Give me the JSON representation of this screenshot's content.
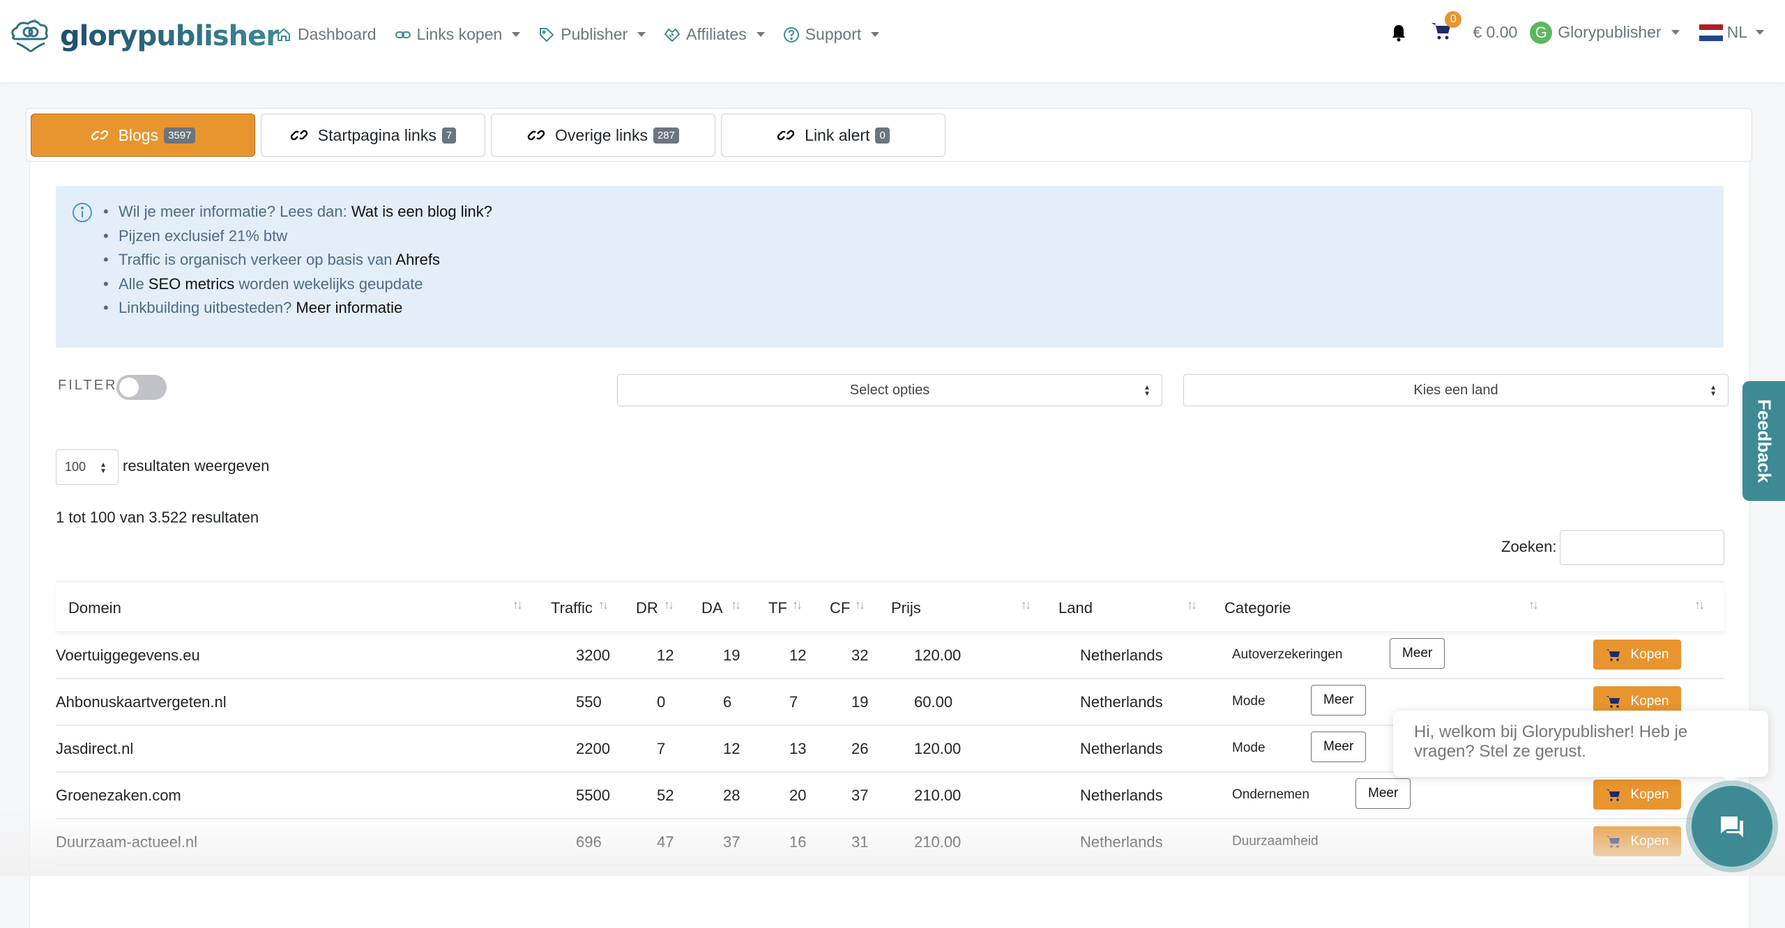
{
  "brand": {
    "name": "glorypublisher",
    "accent": "#e8952f",
    "teal": "#3d8a94"
  },
  "nav": {
    "items": [
      {
        "label": "Dashboard",
        "icon": "home-icon",
        "dropdown": false
      },
      {
        "label": "Links kopen",
        "icon": "link-icon",
        "dropdown": true
      },
      {
        "label": "Publisher",
        "icon": "tag-icon",
        "dropdown": true
      },
      {
        "label": "Affiliates",
        "icon": "handshake-icon",
        "dropdown": true
      },
      {
        "label": "Support",
        "icon": "help-circle-icon",
        "dropdown": true
      }
    ],
    "cart_count": "0",
    "balance": "€ 0.00",
    "user_initial": "G",
    "user_name": "Glorypublisher",
    "language": "NL"
  },
  "tabs": [
    {
      "label": "Blogs",
      "count": "3597",
      "active": true
    },
    {
      "label": "Startpagina links",
      "count": "7",
      "active": false
    },
    {
      "label": "Overige links",
      "count": "287",
      "active": false
    },
    {
      "label": "Link alert",
      "count": "0",
      "active": false
    }
  ],
  "info": {
    "line1_text": "Wil je meer informatie? Lees dan: ",
    "line1_link": "Wat is een blog link?",
    "line2_text": "Pijzen exclusief 21% btw",
    "line3_text": "Traffic is organisch verkeer op basis van ",
    "line3_link": "Ahrefs",
    "line4_pre": "Alle ",
    "line4_link": "SEO metrics",
    "line4_post": " worden wekelijks geupdate",
    "line5_text": "Linkbuilding uitbesteden? ",
    "line5_link": "Meer informatie"
  },
  "filters": {
    "filter_label": "FILTER",
    "filter_enabled": false,
    "options_placeholder": "Select opties",
    "country_placeholder": "Kies een land"
  },
  "listing": {
    "per_page": "100",
    "per_page_label": "resultaten weergeven",
    "results_info": "1 tot 100 van 3.522 resultaten",
    "search_label": "Zoeken:",
    "search_value": ""
  },
  "table": {
    "columns": [
      "Domein",
      "Traffic",
      "DR",
      "DA",
      "TF",
      "CF",
      "Prijs",
      "Land",
      "Categorie",
      ""
    ],
    "meer_label": "Meer",
    "kopen_label": "Kopen",
    "rows": [
      {
        "domain": "Voertuiggegevens.eu",
        "traffic": "3200",
        "dr": "12",
        "da": "19",
        "tf": "12",
        "cf": "32",
        "price": "120.00",
        "country": "Netherlands",
        "category": "Autoverzekeringen",
        "has_meer": true
      },
      {
        "domain": "Ahbonuskaartvergeten.nl",
        "traffic": "550",
        "dr": "0",
        "da": "6",
        "tf": "7",
        "cf": "19",
        "price": "60.00",
        "country": "Netherlands",
        "category": "Mode",
        "has_meer": true
      },
      {
        "domain": "Jasdirect.nl",
        "traffic": "2200",
        "dr": "7",
        "da": "12",
        "tf": "13",
        "cf": "26",
        "price": "120.00",
        "country": "Netherlands",
        "category": "Mode",
        "has_meer": true
      },
      {
        "domain": "Groenezaken.com",
        "traffic": "5500",
        "dr": "52",
        "da": "28",
        "tf": "20",
        "cf": "37",
        "price": "210.00",
        "country": "Netherlands",
        "category": "Ondernemen",
        "has_meer": true
      },
      {
        "domain": "Duurzaam-actueel.nl",
        "traffic": "696",
        "dr": "47",
        "da": "37",
        "tf": "16",
        "cf": "31",
        "price": "210.00",
        "country": "Netherlands",
        "category": "Duurzaamheid",
        "has_meer": false
      }
    ]
  },
  "feedback": {
    "label": "Feedback"
  },
  "chat": {
    "message": "Hi, welkom bij Glorypublisher! Heb je vragen? Stel ze gerust."
  }
}
